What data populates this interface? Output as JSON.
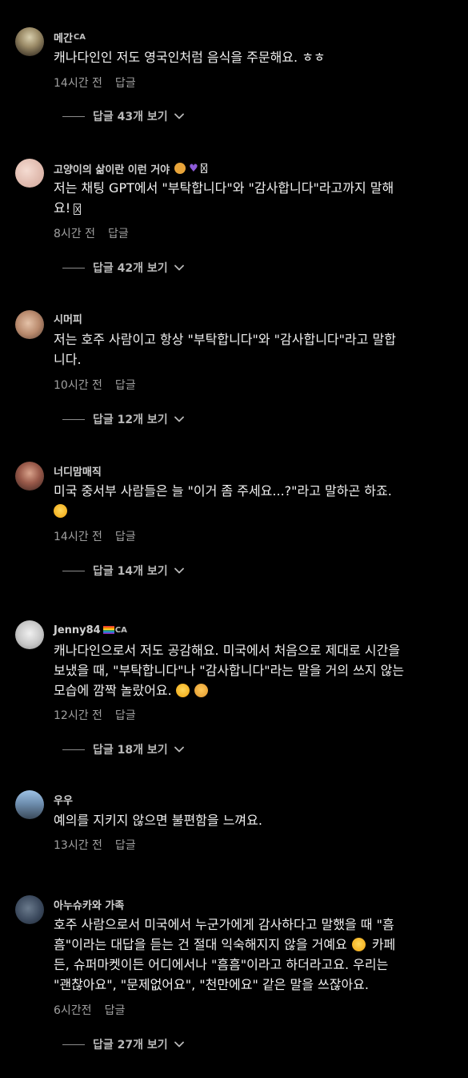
{
  "comments": [
    {
      "username": "메간",
      "flair": "CA",
      "lines": [
        "캐나다인인 저도 영국인처럼 음식을 주문해요. ㅎㅎ"
      ],
      "time": "14시간 전",
      "reply_label": "답글",
      "view_replies_label": "답글 43개 보기",
      "avatar_color": "#8a7b63"
    },
    {
      "username": "고양이의 삶이란 이런 거야",
      "lines": [
        "저는 채팅 GPT에서 \"부탁합니다\"와 \"감사합니다\"라고까지 말해",
        "요!"
      ],
      "time": "8시간 전",
      "reply_label": "답글",
      "view_replies_label": "답글 42개 보기",
      "avatar_color": "#e8c9c0"
    },
    {
      "username": "시머피",
      "lines": [
        "저는 호주 사람이고 항상 \"부탁합니다\"와 \"감사합니다\"라고 말합",
        "니다."
      ],
      "time": "10시간 전",
      "reply_label": "답글",
      "view_replies_label": "답글 12개 보기",
      "avatar_color": "#c9a590"
    },
    {
      "username": "너디맘매직",
      "lines": [
        "미국 중서부 사람들은 늘 \"이거 좀 주세요...?\"라고 말하곤 하죠.",
        ""
      ],
      "time": "14시간 전",
      "reply_label": "답글",
      "view_replies_label": "답글 14개 보기",
      "avatar_color": "#a0685a"
    },
    {
      "username": "Jenny84",
      "flair": "CA",
      "lines": [
        "캐나다인으로서 저도 공감해요. 미국에서 처음으로 제대로 시간을",
        "보냈을 때, \"부탁합니다\"나 \"감사합니다\"라는 말을 거의 쓰지 않는",
        "모습에 깜짝 놀랐어요."
      ],
      "time": "12시간 전",
      "reply_label": "답글",
      "view_replies_label": "답글 18개 보기",
      "avatar_color": "#b7b7b7"
    },
    {
      "username": "우우",
      "lines": [
        "예의를 지키지 않으면 불편함을 느껴요."
      ],
      "time": "13시간 전",
      "reply_label": "답글",
      "avatar_color": "#6f8fb0"
    },
    {
      "username": "아누슈카와 가족",
      "lines": [
        "호주 사람으로서 미국에서 누군가에게 감사하다고 말했을 때 \"흠",
        "흠\"이라는 대답을 듣는 건 절대 익숙해지지 않을 거예요",
        "든, 슈퍼마켓이든 어디에서나 \"흠흠\"이라고 하더라고요. 우리는",
        "\"괜찮아요\", \"문제없어요\", \"천만에요\" 같은 말을 쓰잖아요."
      ],
      "line2_suffix": "카페",
      "time": "6시간전",
      "reply_label": "답글",
      "view_replies_label": "답글 27개 보기",
      "avatar_color": "#3c4a5e"
    }
  ],
  "icons": {
    "chevron": "chevron-down-icon",
    "emoji_laugh": "laughing-emoji-icon",
    "emoji_cat": "cat-emoji-icon",
    "emoji_tongue": "squinting-tongue-emoji-icon",
    "heart": "purple-heart-icon",
    "missing_glyph": "missing-glyph-icon",
    "pride_flag": "pride-flag-icon"
  },
  "colors": {
    "background": "#000000",
    "text": "#f1f1f1",
    "meta": "#9e9e9e"
  }
}
